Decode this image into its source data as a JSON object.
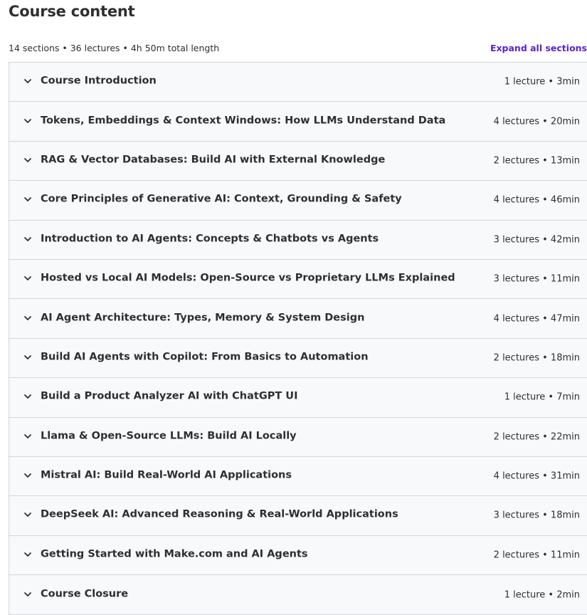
{
  "header": {
    "title": "Course content",
    "summary": "14 sections • 36 lectures • 4h 50m total length",
    "expand_label": "Expand all sections"
  },
  "icons": {
    "section_toggle": "chevron-down-icon"
  },
  "sections": [
    {
      "title": "Course Introduction",
      "meta": "1 lecture • 3min"
    },
    {
      "title": "Tokens, Embeddings & Context Windows: How LLMs Understand Data",
      "meta": "4 lectures • 20min"
    },
    {
      "title": "RAG & Vector Databases: Build AI with External Knowledge",
      "meta": "2 lectures • 13min"
    },
    {
      "title": "Core Principles of Generative AI: Context, Grounding & Safety",
      "meta": "4 lectures • 46min"
    },
    {
      "title": "Introduction to AI Agents: Concepts & Chatbots vs Agents",
      "meta": "3 lectures • 42min"
    },
    {
      "title": "Hosted vs Local AI Models: Open-Source vs Proprietary LLMs Explained",
      "meta": "3 lectures • 11min"
    },
    {
      "title": "AI Agent Architecture: Types, Memory & System Design",
      "meta": "4 lectures • 47min"
    },
    {
      "title": "Build AI Agents with Copilot: From Basics to Automation",
      "meta": "2 lectures • 18min"
    },
    {
      "title": "Build a Product Analyzer AI with ChatGPT UI",
      "meta": "1 lecture • 7min"
    },
    {
      "title": "Llama & Open-Source LLMs: Build AI Locally",
      "meta": "2 lectures • 22min"
    },
    {
      "title": "Mistral AI: Build Real-World AI Applications",
      "meta": "4 lectures • 31min"
    },
    {
      "title": "DeepSeek AI: Advanced Reasoning & Real-World Applications",
      "meta": "3 lectures • 18min"
    },
    {
      "title": "Getting Started with Make.com and AI Agents",
      "meta": "2 lectures • 11min"
    },
    {
      "title": "Course Closure",
      "meta": "1 lecture • 2min"
    }
  ],
  "colors": {
    "text": "#2d2f31",
    "link": "#5624d0",
    "section_bg": "#f7f9fa",
    "border": "#d1d7dc"
  }
}
